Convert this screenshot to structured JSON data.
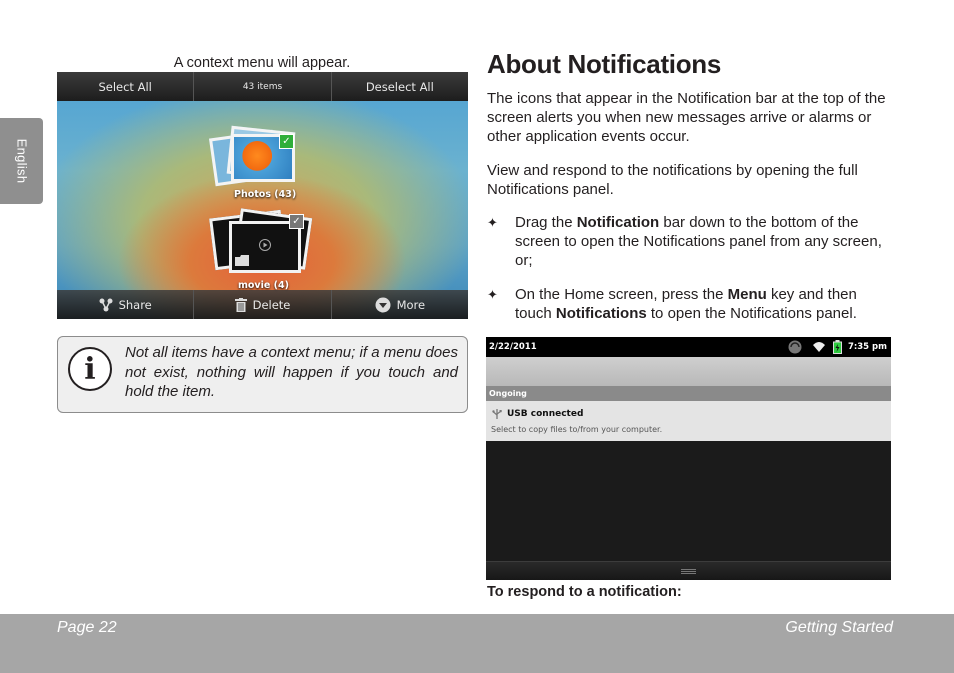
{
  "sidebar_tab": {
    "label": "English"
  },
  "left": {
    "caption": "A context menu will appear.",
    "context_menu": {
      "top_bar": {
        "select_all": "Select All",
        "count": "43 items",
        "deselect_all": "Deselect All"
      },
      "albums": [
        {
          "label": "Photos  (43)"
        },
        {
          "label": "movie  (4)"
        }
      ],
      "bottom_bar": {
        "share": "Share",
        "delete": "Delete",
        "more": "More"
      }
    },
    "note": {
      "icon": "info-icon",
      "text": "Not all items have a context menu; if a menu does not exist, nothing will happen if you touch and hold the item."
    }
  },
  "right": {
    "title": "About Notifications",
    "paragraph1": "The icons that appear in the Notification bar at the top of the screen alerts you when new messages arrive or alarms or other application events occur.",
    "paragraph2": "View and respond to the notifications by opening the full Notifications panel.",
    "bullets": [
      {
        "pre": "Drag the ",
        "bold": "Notification",
        "post": " bar down to the bottom of the screen to open the Notifications panel from any screen, or;"
      },
      {
        "pre": "On the Home screen, press the ",
        "bold": "Menu",
        "mid": " key and then touch ",
        "bold2": "Notifications",
        "post": " to open the Notifications panel."
      }
    ],
    "notification_panel": {
      "date": "2/22/2011",
      "time": "7:35 pm",
      "section": "Ongoing",
      "item_title": "USB connected",
      "item_subtitle": "Select to copy files to/from your computer."
    },
    "respond_heading": "To respond to a notification:"
  },
  "footer": {
    "page": "Page 22",
    "section": "Getting Started"
  },
  "colors": {
    "footer_bg": "#a6a6a6",
    "tab_bg": "#8f8f8f",
    "note_bg": "#efefef"
  }
}
